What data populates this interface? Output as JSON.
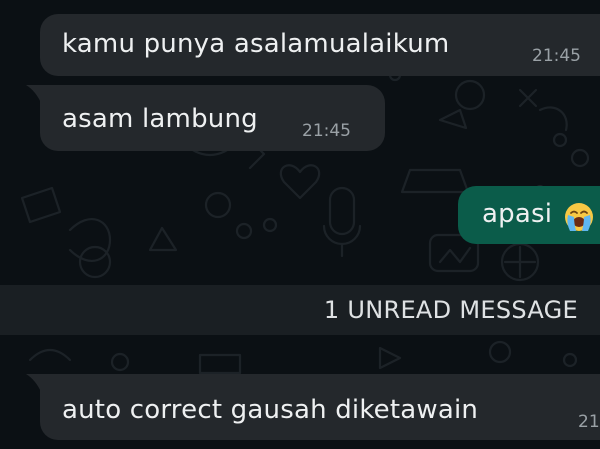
{
  "messages": [
    {
      "direction": "incoming",
      "text": "kamu punya asalamualaikum",
      "time": "21:45"
    },
    {
      "direction": "incoming",
      "text": "asam lambung",
      "time": "21:45"
    },
    {
      "direction": "outgoing",
      "text": "apasi",
      "emoji": "crying-face-emoji"
    },
    {
      "direction": "incoming",
      "text": "auto correct gausah diketawain",
      "time": "21"
    }
  ],
  "unread_banner": {
    "label": "1 UNREAD MESSAGE"
  },
  "colors": {
    "background": "#0b1014",
    "incoming_bubble": "#24282c",
    "outgoing_bubble": "#0b5c4a",
    "text": "#eef0f1",
    "timestamp": "#9aa1a6",
    "unread_bar": "#1a1f23"
  }
}
